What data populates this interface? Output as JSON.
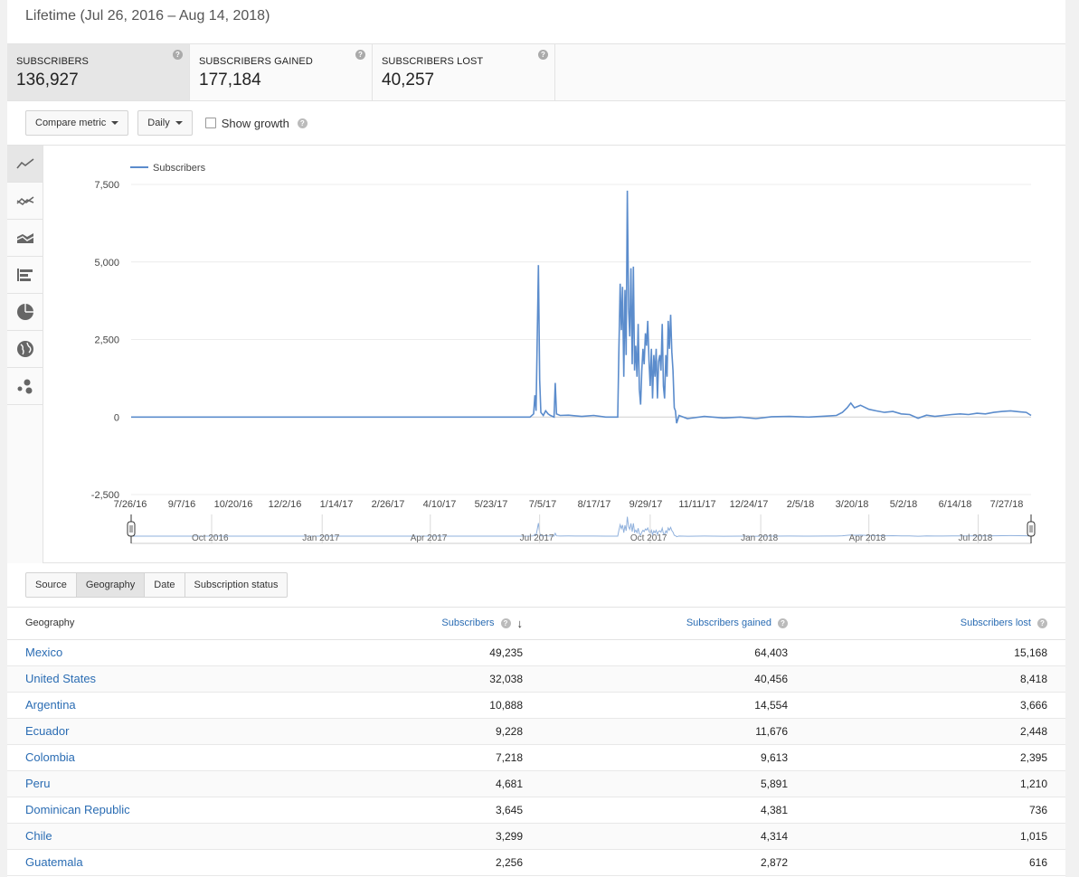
{
  "header": {
    "title": "Lifetime (Jul 26, 2016 – Aug 14, 2018)"
  },
  "metrics": [
    {
      "label": "SUBSCRIBERS",
      "value": "136,927",
      "active": true
    },
    {
      "label": "SUBSCRIBERS GAINED",
      "value": "177,184",
      "active": false
    },
    {
      "label": "SUBSCRIBERS LOST",
      "value": "40,257",
      "active": false
    }
  ],
  "toolbar": {
    "compare_label": "Compare metric",
    "interval_label": "Daily",
    "show_growth_label": "Show growth"
  },
  "chart_types": [
    "line-chart-icon",
    "multiline-chart-icon",
    "stacked-area-icon",
    "bar-chart-icon",
    "pie-chart-icon",
    "globe-map-icon",
    "bubble-chart-icon"
  ],
  "chart_data": {
    "type": "line",
    "series": [
      {
        "name": "Subscribers",
        "color": "#5b8ccc",
        "points": [
          [
            "2016-07-26",
            0
          ],
          [
            "2016-09-07",
            0
          ],
          [
            "2016-10-20",
            0
          ],
          [
            "2016-12-02",
            0
          ],
          [
            "2017-01-14",
            0
          ],
          [
            "2017-02-26",
            0
          ],
          [
            "2017-04-10",
            0
          ],
          [
            "2017-05-23",
            0
          ],
          [
            "2017-06-23",
            0
          ],
          [
            "2017-06-26",
            100
          ],
          [
            "2017-06-27",
            700
          ],
          [
            "2017-06-28",
            200
          ],
          [
            "2017-06-30",
            4900
          ],
          [
            "2017-07-01",
            1200
          ],
          [
            "2017-07-02",
            150
          ],
          [
            "2017-07-04",
            50
          ],
          [
            "2017-07-06",
            200
          ],
          [
            "2017-07-08",
            100
          ],
          [
            "2017-07-10",
            50
          ],
          [
            "2017-07-13",
            0
          ],
          [
            "2017-07-14",
            1100
          ],
          [
            "2017-07-15",
            100
          ],
          [
            "2017-07-18",
            50
          ],
          [
            "2017-07-25",
            60
          ],
          [
            "2017-08-05",
            20
          ],
          [
            "2017-08-15",
            50
          ],
          [
            "2017-08-25",
            0
          ],
          [
            "2017-09-04",
            0
          ],
          [
            "2017-09-05",
            2200
          ],
          [
            "2017-09-06",
            4300
          ],
          [
            "2017-09-07",
            2800
          ],
          [
            "2017-09-08",
            4200
          ],
          [
            "2017-09-09",
            1300
          ],
          [
            "2017-09-10",
            4100
          ],
          [
            "2017-09-11",
            2000
          ],
          [
            "2017-09-12",
            7300
          ],
          [
            "2017-09-13",
            3500
          ],
          [
            "2017-09-14",
            2600
          ],
          [
            "2017-09-15",
            4800
          ],
          [
            "2017-09-16",
            1700
          ],
          [
            "2017-09-17",
            4850
          ],
          [
            "2017-09-18",
            1500
          ],
          [
            "2017-09-19",
            2300
          ],
          [
            "2017-09-20",
            1300
          ],
          [
            "2017-09-21",
            3000
          ],
          [
            "2017-09-22",
            900
          ],
          [
            "2017-09-23",
            400
          ],
          [
            "2017-09-24",
            1500
          ],
          [
            "2017-09-25",
            2200
          ],
          [
            "2017-09-26",
            1700
          ],
          [
            "2017-09-27",
            2700
          ],
          [
            "2017-09-28",
            2300
          ],
          [
            "2017-09-29",
            3100
          ],
          [
            "2017-09-30",
            1800
          ],
          [
            "2017-10-01",
            1000
          ],
          [
            "2017-10-02",
            2200
          ],
          [
            "2017-10-03",
            600
          ],
          [
            "2017-10-04",
            2000
          ],
          [
            "2017-10-05",
            1300
          ],
          [
            "2017-10-06",
            2200
          ],
          [
            "2017-10-07",
            600
          ],
          [
            "2017-10-08",
            1800
          ],
          [
            "2017-10-09",
            2000
          ],
          [
            "2017-10-10",
            1500
          ],
          [
            "2017-10-11",
            3000
          ],
          [
            "2017-10-12",
            1000
          ],
          [
            "2017-10-13",
            600
          ],
          [
            "2017-10-14",
            2000
          ],
          [
            "2017-10-15",
            1300
          ],
          [
            "2017-10-16",
            3100
          ],
          [
            "2017-10-17",
            2200
          ],
          [
            "2017-10-18",
            3300
          ],
          [
            "2017-10-19",
            2100
          ],
          [
            "2017-10-20",
            1500
          ],
          [
            "2017-10-21",
            300
          ],
          [
            "2017-10-22",
            200
          ],
          [
            "2017-10-23",
            -200
          ],
          [
            "2017-10-25",
            50
          ],
          [
            "2017-11-01",
            -50
          ],
          [
            "2017-11-15",
            20
          ],
          [
            "2017-12-01",
            -30
          ],
          [
            "2017-12-15",
            0
          ],
          [
            "2017-12-28",
            -50
          ],
          [
            "2018-01-10",
            10
          ],
          [
            "2018-01-25",
            20
          ],
          [
            "2018-02-10",
            0
          ],
          [
            "2018-02-25",
            30
          ],
          [
            "2018-03-05",
            50
          ],
          [
            "2018-03-10",
            150
          ],
          [
            "2018-03-14",
            300
          ],
          [
            "2018-03-17",
            450
          ],
          [
            "2018-03-20",
            300
          ],
          [
            "2018-03-25",
            380
          ],
          [
            "2018-04-01",
            250
          ],
          [
            "2018-04-07",
            200
          ],
          [
            "2018-04-14",
            150
          ],
          [
            "2018-04-21",
            180
          ],
          [
            "2018-04-28",
            100
          ],
          [
            "2018-05-05",
            80
          ],
          [
            "2018-05-12",
            -40
          ],
          [
            "2018-05-19",
            60
          ],
          [
            "2018-05-26",
            20
          ],
          [
            "2018-06-02",
            50
          ],
          [
            "2018-06-09",
            80
          ],
          [
            "2018-06-16",
            100
          ],
          [
            "2018-06-23",
            80
          ],
          [
            "2018-06-30",
            120
          ],
          [
            "2018-07-07",
            100
          ],
          [
            "2018-07-14",
            150
          ],
          [
            "2018-07-21",
            180
          ],
          [
            "2018-07-28",
            200
          ],
          [
            "2018-08-04",
            170
          ],
          [
            "2018-08-10",
            150
          ],
          [
            "2018-08-14",
            50
          ]
        ]
      }
    ],
    "ylim": [
      -2500,
      7500
    ],
    "yticks": [
      "7,500",
      "5,000",
      "2,500",
      "0",
      "-2,500"
    ],
    "xticks": [
      "7/26/16",
      "9/7/16",
      "10/20/16",
      "12/2/16",
      "1/14/17",
      "2/26/17",
      "4/10/17",
      "5/23/17",
      "7/5/17",
      "8/17/17",
      "9/29/17",
      "11/11/17",
      "12/24/17",
      "2/5/18",
      "3/20/18",
      "5/2/18",
      "6/14/18",
      "7/27/18"
    ],
    "legend": "top-left",
    "grid": true,
    "navigator_labels": [
      "Oct 2016",
      "Jan 2017",
      "Apr 2017",
      "Jul 2017",
      "Oct 2017",
      "Jan 2018",
      "Apr 2018",
      "Jul 2018"
    ]
  },
  "tabs": [
    "Source",
    "Geography",
    "Date",
    "Subscription status"
  ],
  "active_tab": "Geography",
  "table": {
    "headers": [
      "Geography",
      "Subscribers",
      "Subscribers gained",
      "Subscribers lost"
    ],
    "rows": [
      [
        "Mexico",
        "49,235",
        "64,403",
        "15,168"
      ],
      [
        "United States",
        "32,038",
        "40,456",
        "8,418"
      ],
      [
        "Argentina",
        "10,888",
        "14,554",
        "3,666"
      ],
      [
        "Ecuador",
        "9,228",
        "11,676",
        "2,448"
      ],
      [
        "Colombia",
        "7,218",
        "9,613",
        "2,395"
      ],
      [
        "Peru",
        "4,681",
        "5,891",
        "1,210"
      ],
      [
        "Dominican Republic",
        "3,645",
        "4,381",
        "736"
      ],
      [
        "Chile",
        "3,299",
        "4,314",
        "1,015"
      ],
      [
        "Guatemala",
        "2,256",
        "2,872",
        "616"
      ]
    ]
  }
}
